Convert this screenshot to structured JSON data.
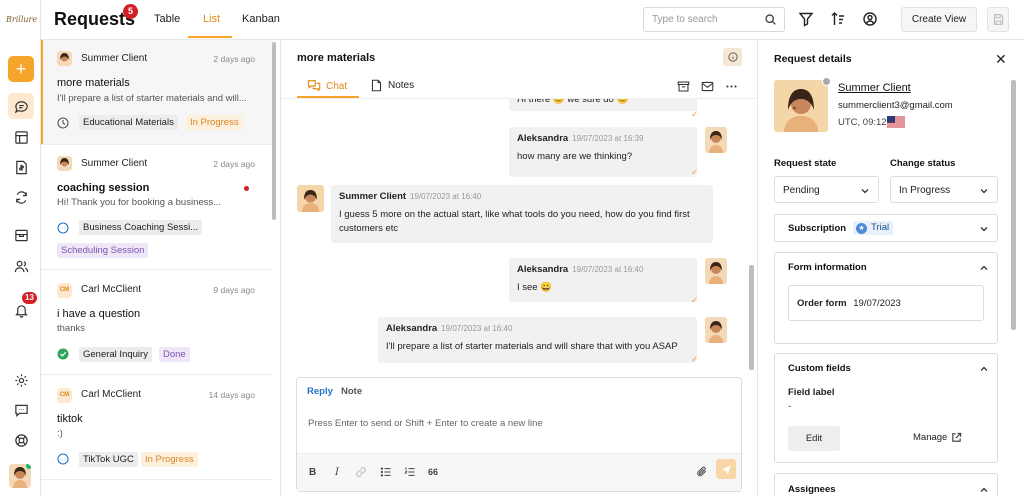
{
  "app": {
    "title": "Requests",
    "title_badge": "5",
    "logo_text": "Brillure",
    "tabs": [
      {
        "label": "Table"
      },
      {
        "label": "List"
      },
      {
        "label": "Kanban"
      }
    ],
    "active_tab": "List",
    "search_placeholder": "Type to search",
    "create_view_label": "Create View",
    "accent_color": "#f4a52a",
    "badge_color": "#d32027"
  },
  "rail": {
    "notification_count": "13",
    "icons": [
      "plus-icon",
      "chat-icon",
      "table-icon",
      "invoice-icon",
      "sync-icon",
      "inbox-icon",
      "users-icon",
      "bell-icon",
      "settings-icon",
      "feedback-icon",
      "help-icon"
    ]
  },
  "requests": [
    {
      "client": "Summer Client",
      "time": "2 days ago",
      "subject": "more materials",
      "preview": "I'll prepare a list of starter materials and will...",
      "type_tag": "Educational Materials",
      "status_tag": "In Progress",
      "active": true
    },
    {
      "client": "Summer Client",
      "time": "2 days ago",
      "subject": "coaching session",
      "preview": "Hi! Thank you for booking a business...",
      "type_tag": "Business Coaching Sessi...",
      "status_tag": "Scheduling Session",
      "unread": true
    },
    {
      "client": "Carl McClient",
      "initials": "CM",
      "time": "9 days ago",
      "subject": "i have a question",
      "preview": "thanks",
      "type_tag": "General Inquiry",
      "status_tag": "Done"
    },
    {
      "client": "Carl McClient",
      "initials": "CM",
      "time": "14 days ago",
      "subject": "tiktok",
      "preview": ":)",
      "type_tag": "TikTok UGC",
      "status_tag": "In Progress"
    }
  ],
  "chat": {
    "title": "more materials",
    "tabs": [
      {
        "label": "Chat"
      },
      {
        "label": "Notes"
      }
    ],
    "messages": [
      {
        "author": "",
        "time": "",
        "text": "Hi there 😊 we sure do 😊"
      },
      {
        "author": "Aleksandra",
        "time": "19/07/2023 at 16:39",
        "text": "how many are we thinking?"
      },
      {
        "author": "Summer Client",
        "time": "19/07/2023 at 16:40",
        "text": "I guess 5 more on the actual start, like what tools do you need, how do you find first customers etc"
      },
      {
        "author": "Aleksandra",
        "time": "19/07/2023 at 16:40",
        "text": "I see 😀"
      },
      {
        "author": "Aleksandra",
        "time": "19/07/2023 at 16:40",
        "text": "I'll prepare a list of starter materials and will share that with you ASAP"
      }
    ],
    "composer": {
      "reply_label": "Reply",
      "note_label": "Note",
      "placeholder": "Press Enter to send or Shift + Enter to create a new line",
      "format": {
        "bold": "B",
        "italic": "I",
        "quote": "66"
      }
    }
  },
  "details": {
    "title": "Request details",
    "client_name": "Summer Client",
    "client_email": "summerclient3@gmail.com",
    "timezone": "UTC, 09:12",
    "request_state_label": "Request state",
    "request_state_value": "Pending",
    "change_status_label": "Change status",
    "change_status_value": "In Progress",
    "subscription_label": "Subscription",
    "subscription_value": "Trial",
    "form_info_label": "Form information",
    "order_form_label": "Order form",
    "order_form_date": "19/07/2023",
    "custom_fields_label": "Custom fields",
    "field_label": "Field label",
    "field_value": "-",
    "edit_label": "Edit",
    "manage_label": "Manage",
    "assignees_label": "Assignees"
  }
}
